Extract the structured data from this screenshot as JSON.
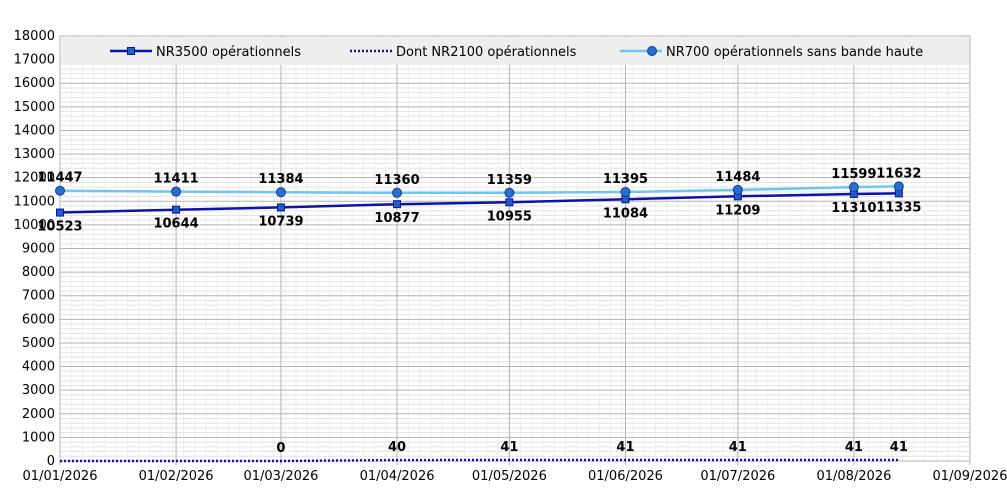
{
  "chart_data": {
    "type": "line",
    "x_ticks": [
      "01/01/2026",
      "01/02/2026",
      "01/03/2026",
      "01/04/2026",
      "01/05/2026",
      "01/06/2026",
      "01/07/2026",
      "01/08/2026",
      "01/09/2026"
    ],
    "x_range": [
      "2026-01-01",
      "2026-09-01"
    ],
    "ylim": [
      0,
      18000
    ],
    "y_ticks": [
      0,
      1000,
      2000,
      3000,
      4000,
      5000,
      6000,
      7000,
      8000,
      9000,
      10000,
      11000,
      12000,
      13000,
      14000,
      15000,
      16000,
      17000,
      18000
    ],
    "grid": true,
    "legend_position": "top",
    "series": [
      {
        "name": "NR3500 opérationnels",
        "color": "#0a14a8",
        "style": "solid",
        "marker": "square",
        "x": [
          "2026-01-01",
          "2026-02-01",
          "2026-03-01",
          "2026-04-01",
          "2026-05-01",
          "2026-06-01",
          "2026-07-01",
          "2026-08-01",
          "2026-08-13"
        ],
        "values": [
          10523,
          10644,
          10739,
          10877,
          10955,
          11084,
          11209,
          11310,
          11335
        ],
        "labels": [
          "10523",
          "10644",
          "10739",
          "10877",
          "10955",
          "11084",
          "11209",
          "11310",
          "11335"
        ]
      },
      {
        "name": "Dont NR2100 opérationnels",
        "color": "#0a14a8",
        "style": "dotted",
        "marker": "none",
        "x": [
          "2026-01-01",
          "2026-02-01",
          "2026-03-01",
          "2026-04-01",
          "2026-05-01",
          "2026-06-01",
          "2026-07-01",
          "2026-08-01",
          "2026-08-13"
        ],
        "values": [
          0,
          0,
          0,
          40,
          41,
          41,
          41,
          41,
          41
        ],
        "labels": [
          "",
          "",
          "0",
          "40",
          "41",
          "41",
          "41",
          "41",
          "41"
        ]
      },
      {
        "name": "NR700 opérationnels sans bande haute",
        "color": "#6ec6f0",
        "style": "solid",
        "marker": "circle",
        "x": [
          "2026-01-01",
          "2026-02-01",
          "2026-03-01",
          "2026-04-01",
          "2026-05-01",
          "2026-06-01",
          "2026-07-01",
          "2026-08-01",
          "2026-08-13"
        ],
        "values": [
          11447,
          11411,
          11384,
          11360,
          11359,
          11395,
          11484,
          11599,
          11632
        ],
        "labels": [
          "11447",
          "11411",
          "11384",
          "11360",
          "11359",
          "11395",
          "11484",
          "11599",
          "11632"
        ]
      }
    ]
  }
}
